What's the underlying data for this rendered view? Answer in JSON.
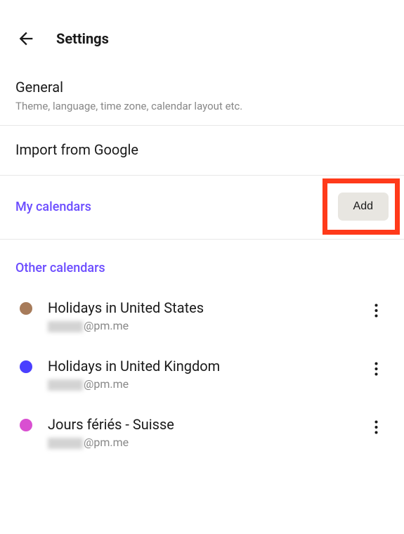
{
  "header": {
    "title": "Settings"
  },
  "general": {
    "title": "General",
    "subtitle": "Theme, language, time zone, calendar layout etc."
  },
  "import": {
    "title": "Import from Google"
  },
  "myCalendars": {
    "title": "My calendars",
    "addLabel": "Add"
  },
  "otherCalendars": {
    "title": "Other calendars",
    "items": [
      {
        "name": "Holidays in United States",
        "emailSuffix": "@pm.me",
        "color": "#a77b5a"
      },
      {
        "name": "Holidays in United Kingdom",
        "emailSuffix": "@pm.me",
        "color": "#4a3fff"
      },
      {
        "name": "Jours fériés - Suisse",
        "emailSuffix": "@pm.me",
        "color": "#d94fd1"
      }
    ]
  }
}
